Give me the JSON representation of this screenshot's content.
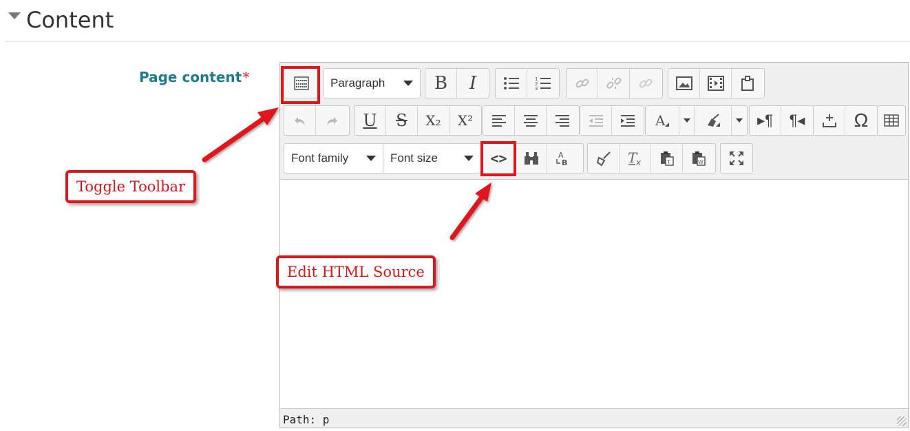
{
  "section": {
    "title": "Content"
  },
  "field": {
    "label": "Page content",
    "required": "*"
  },
  "toolbar": {
    "paragraph_label": "Paragraph",
    "font_family_label": "Font family",
    "font_size_label": "Font size",
    "bold": "B",
    "italic": "I",
    "underline": "U",
    "strikethrough": "S",
    "subscript": "X₂",
    "superscript": "X²",
    "omega": "Ω",
    "source_code": "<>"
  },
  "statusbar": {
    "path": "Path: p"
  },
  "annotations": {
    "toggle_toolbar": "Toggle Toolbar",
    "edit_html_source": "Edit HTML Source"
  },
  "colors": {
    "annotation": "#e0161b",
    "label": "#1f7a8c"
  }
}
